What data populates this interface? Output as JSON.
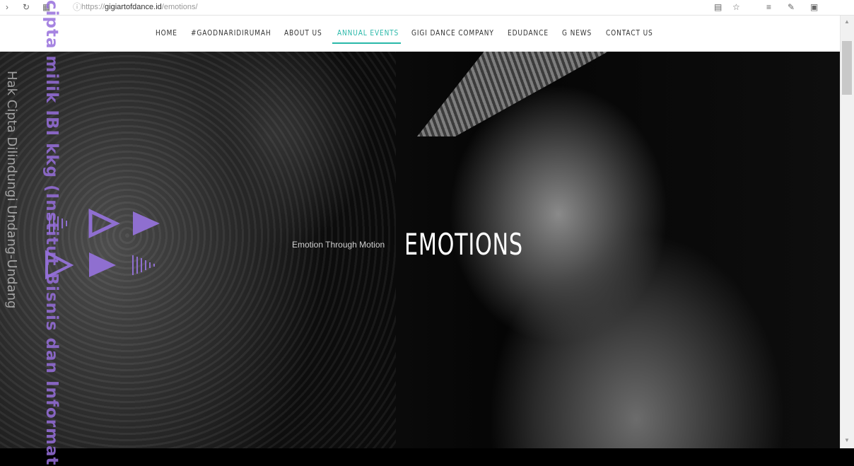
{
  "browser": {
    "url_prefix": "https://",
    "url_host": "gigiartofdance.id",
    "url_path": "/emotions/",
    "back_icon": "back-arrow-icon",
    "refresh_icon": "refresh-icon",
    "tab_icon": "tabs-icon"
  },
  "nav": {
    "items": [
      {
        "label": "HOME"
      },
      {
        "label": "#GAODNARIDIRUMAH"
      },
      {
        "label": "ABOUT US"
      },
      {
        "label": "ANNUAL EVENTS",
        "active": true
      },
      {
        "label": "GIGI DANCE COMPANY"
      },
      {
        "label": "EDUDANCE"
      },
      {
        "label": "G NEWS"
      },
      {
        "label": "CONTACT US"
      }
    ],
    "accent_color": "#29b8a9"
  },
  "hero": {
    "tagline": "Emotion Through Motion",
    "title": "EMOTIONS",
    "deco_color": "#8f6fd0"
  },
  "watermark": {
    "line1": "Hak Cipta Dilindungi Undang-Undang",
    "line2": "cipta milik IBI kkg (Institut Bisnis dan Informat"
  }
}
